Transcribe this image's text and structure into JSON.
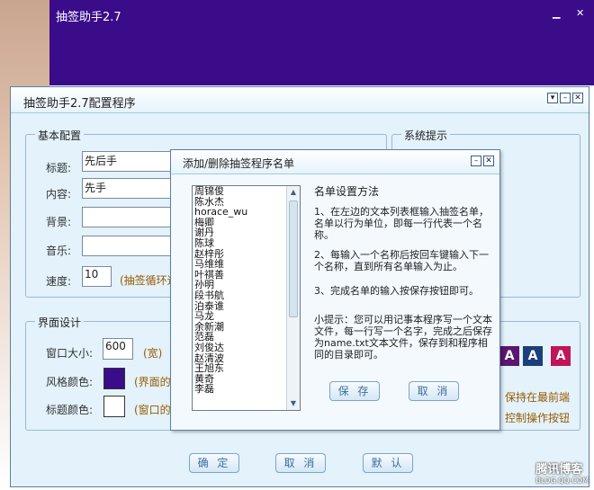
{
  "background_window": {
    "title": "抽签助手2.7"
  },
  "config_window": {
    "title": "抽签助手2.7配置程序",
    "basic": {
      "group_label": "基本配置",
      "title_label": "标题:",
      "title_value": "先后手",
      "content_label": "内容:",
      "content_value": "先手",
      "bg_label": "背景:",
      "bg_value": "",
      "music_label": "音乐:",
      "music_value": "",
      "speed_label": "速度:",
      "speed_value": "10",
      "speed_hint": "(抽签循环速"
    },
    "tips": {
      "group_label": "系统提示"
    },
    "ui": {
      "group_label": "界面设计",
      "size_label": "窗口大小:",
      "size_value": "600",
      "size_unit": "(宽)",
      "style_label": "风格颜色:",
      "style_hint": "(界面的",
      "title_color_label": "标题颜色:",
      "title_color_hint": "(窗口的"
    },
    "right": {
      "theme_letter": "A",
      "topmost": "保持在最前端",
      "control": "控制操作按钮"
    },
    "colors": {
      "style_swatch": "#3a0c8a",
      "title_swatch": "#ffffff"
    },
    "buttons": {
      "ok": "确 定",
      "cancel": "取 消",
      "default": "默 认"
    }
  },
  "dialog": {
    "title": "添加/删除抽签程序名单",
    "names": [
      "周锦俊",
      "陈水杰",
      "horace_wu",
      "梅卿",
      "谢丹",
      "陈球",
      "赵梓彤",
      "马维维",
      "叶祺善",
      "孙明",
      "段书航",
      "泊泰谁",
      "马龙",
      "余新潮",
      "范磊",
      "刘俊达",
      "赵清波",
      "王旭东",
      "黄奇",
      "李磊"
    ],
    "help_title": "名单设置方法",
    "help_1": "1、在左边的文本列表框输入抽签名单，名单以行为单位，即每一行代表一个名称。",
    "help_2": "2、每输入一个名称后按回车键输入下一个名称，直到所有名单输入为止。",
    "help_3": "3、完成名单的输入按保存按钮即可。",
    "help_4": "小提示：您可以用记事本程序写一个文本文件，每一行写一个名字，完成之后保存为name.txt文本文件，保存到和程序相同的目录即可。",
    "save": "保 存",
    "cancel": "取 消"
  },
  "watermark": {
    "text": "腾讯博客",
    "sub": "BLOG.QQ.COM"
  }
}
